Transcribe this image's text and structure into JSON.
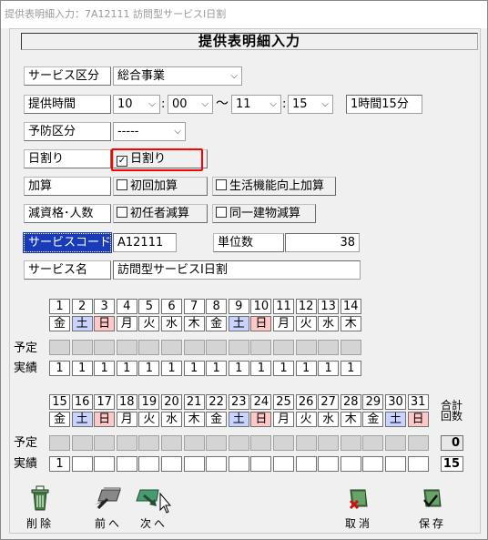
{
  "window": {
    "title": "提供表明細入力：7A12111 訪問型サービスⅠ日割"
  },
  "header": {
    "title": "提供表明細入力"
  },
  "form": {
    "service_kubun_label": "サービス区分",
    "service_kubun_value": "総合事業",
    "time_label": "提供時間",
    "start_hour": "10",
    "start_min": "00",
    "colon": ":",
    "tilde": "〜",
    "end_hour": "11",
    "end_min": "15",
    "duration": "1時間15分",
    "yobo_label": "予防区分",
    "yobo_value": "-----",
    "hiwari_label": "日割り",
    "hiwari_check": "日割り",
    "kasan_label": "加算",
    "kasan_1": "初回加算",
    "kasan_2": "生活機能向上加算",
    "gensan_label": "減資格･人数",
    "gensan_1": "初任者減算",
    "gensan_2": "同一建物減算",
    "code_label": "サービスコード",
    "code_value": "A12111",
    "unit_label": "単位数",
    "unit_value": "38",
    "name_label": "サービス名",
    "name_value": "訪問型サービスⅠ日割"
  },
  "calendar": {
    "plan_label": "予定",
    "actual_label": "実績",
    "total_label_1": "合計",
    "total_label_2": "回数",
    "plan_total": "0",
    "actual_total": "15",
    "week1": [
      {
        "d": "1",
        "w": "金",
        "t": "",
        "a": "1"
      },
      {
        "d": "2",
        "w": "土",
        "t": "sat",
        "a": "1"
      },
      {
        "d": "3",
        "w": "日",
        "t": "sun",
        "a": "1"
      },
      {
        "d": "4",
        "w": "月",
        "t": "",
        "a": "1"
      },
      {
        "d": "5",
        "w": "火",
        "t": "",
        "a": "1"
      },
      {
        "d": "6",
        "w": "水",
        "t": "",
        "a": "1"
      },
      {
        "d": "7",
        "w": "木",
        "t": "",
        "a": "1"
      },
      {
        "d": "8",
        "w": "金",
        "t": "",
        "a": "1"
      },
      {
        "d": "9",
        "w": "土",
        "t": "sat",
        "a": "1"
      },
      {
        "d": "10",
        "w": "日",
        "t": "sun",
        "a": "1"
      },
      {
        "d": "11",
        "w": "月",
        "t": "",
        "a": "1"
      },
      {
        "d": "12",
        "w": "火",
        "t": "",
        "a": "1"
      },
      {
        "d": "13",
        "w": "水",
        "t": "",
        "a": "1"
      },
      {
        "d": "14",
        "w": "木",
        "t": "",
        "a": "1"
      }
    ],
    "week2": [
      {
        "d": "15",
        "w": "金",
        "t": "",
        "a": "1"
      },
      {
        "d": "16",
        "w": "土",
        "t": "sat",
        "a": ""
      },
      {
        "d": "17",
        "w": "日",
        "t": "sun",
        "a": ""
      },
      {
        "d": "18",
        "w": "月",
        "t": "",
        "a": ""
      },
      {
        "d": "19",
        "w": "火",
        "t": "",
        "a": ""
      },
      {
        "d": "20",
        "w": "水",
        "t": "",
        "a": ""
      },
      {
        "d": "21",
        "w": "木",
        "t": "",
        "a": ""
      },
      {
        "d": "22",
        "w": "金",
        "t": "",
        "a": ""
      },
      {
        "d": "23",
        "w": "土",
        "t": "sat",
        "a": ""
      },
      {
        "d": "24",
        "w": "日",
        "t": "sun",
        "a": ""
      },
      {
        "d": "25",
        "w": "月",
        "t": "",
        "a": ""
      },
      {
        "d": "26",
        "w": "火",
        "t": "",
        "a": ""
      },
      {
        "d": "27",
        "w": "水",
        "t": "",
        "a": ""
      },
      {
        "d": "28",
        "w": "木",
        "t": "",
        "a": ""
      },
      {
        "d": "29",
        "w": "金",
        "t": "",
        "a": ""
      },
      {
        "d": "30",
        "w": "土",
        "t": "sat",
        "a": ""
      },
      {
        "d": "31",
        "w": "日",
        "t": "sun",
        "a": ""
      }
    ]
  },
  "toolbar": {
    "delete": "削除",
    "prev": "前へ",
    "next": "次へ",
    "cancel": "取消",
    "save": "保存"
  },
  "colors": {
    "saturday": "#c8d4ff",
    "sunday": "#ffc8c8",
    "selected_label": "#1a3bb8",
    "highlight": "#ff0000"
  }
}
